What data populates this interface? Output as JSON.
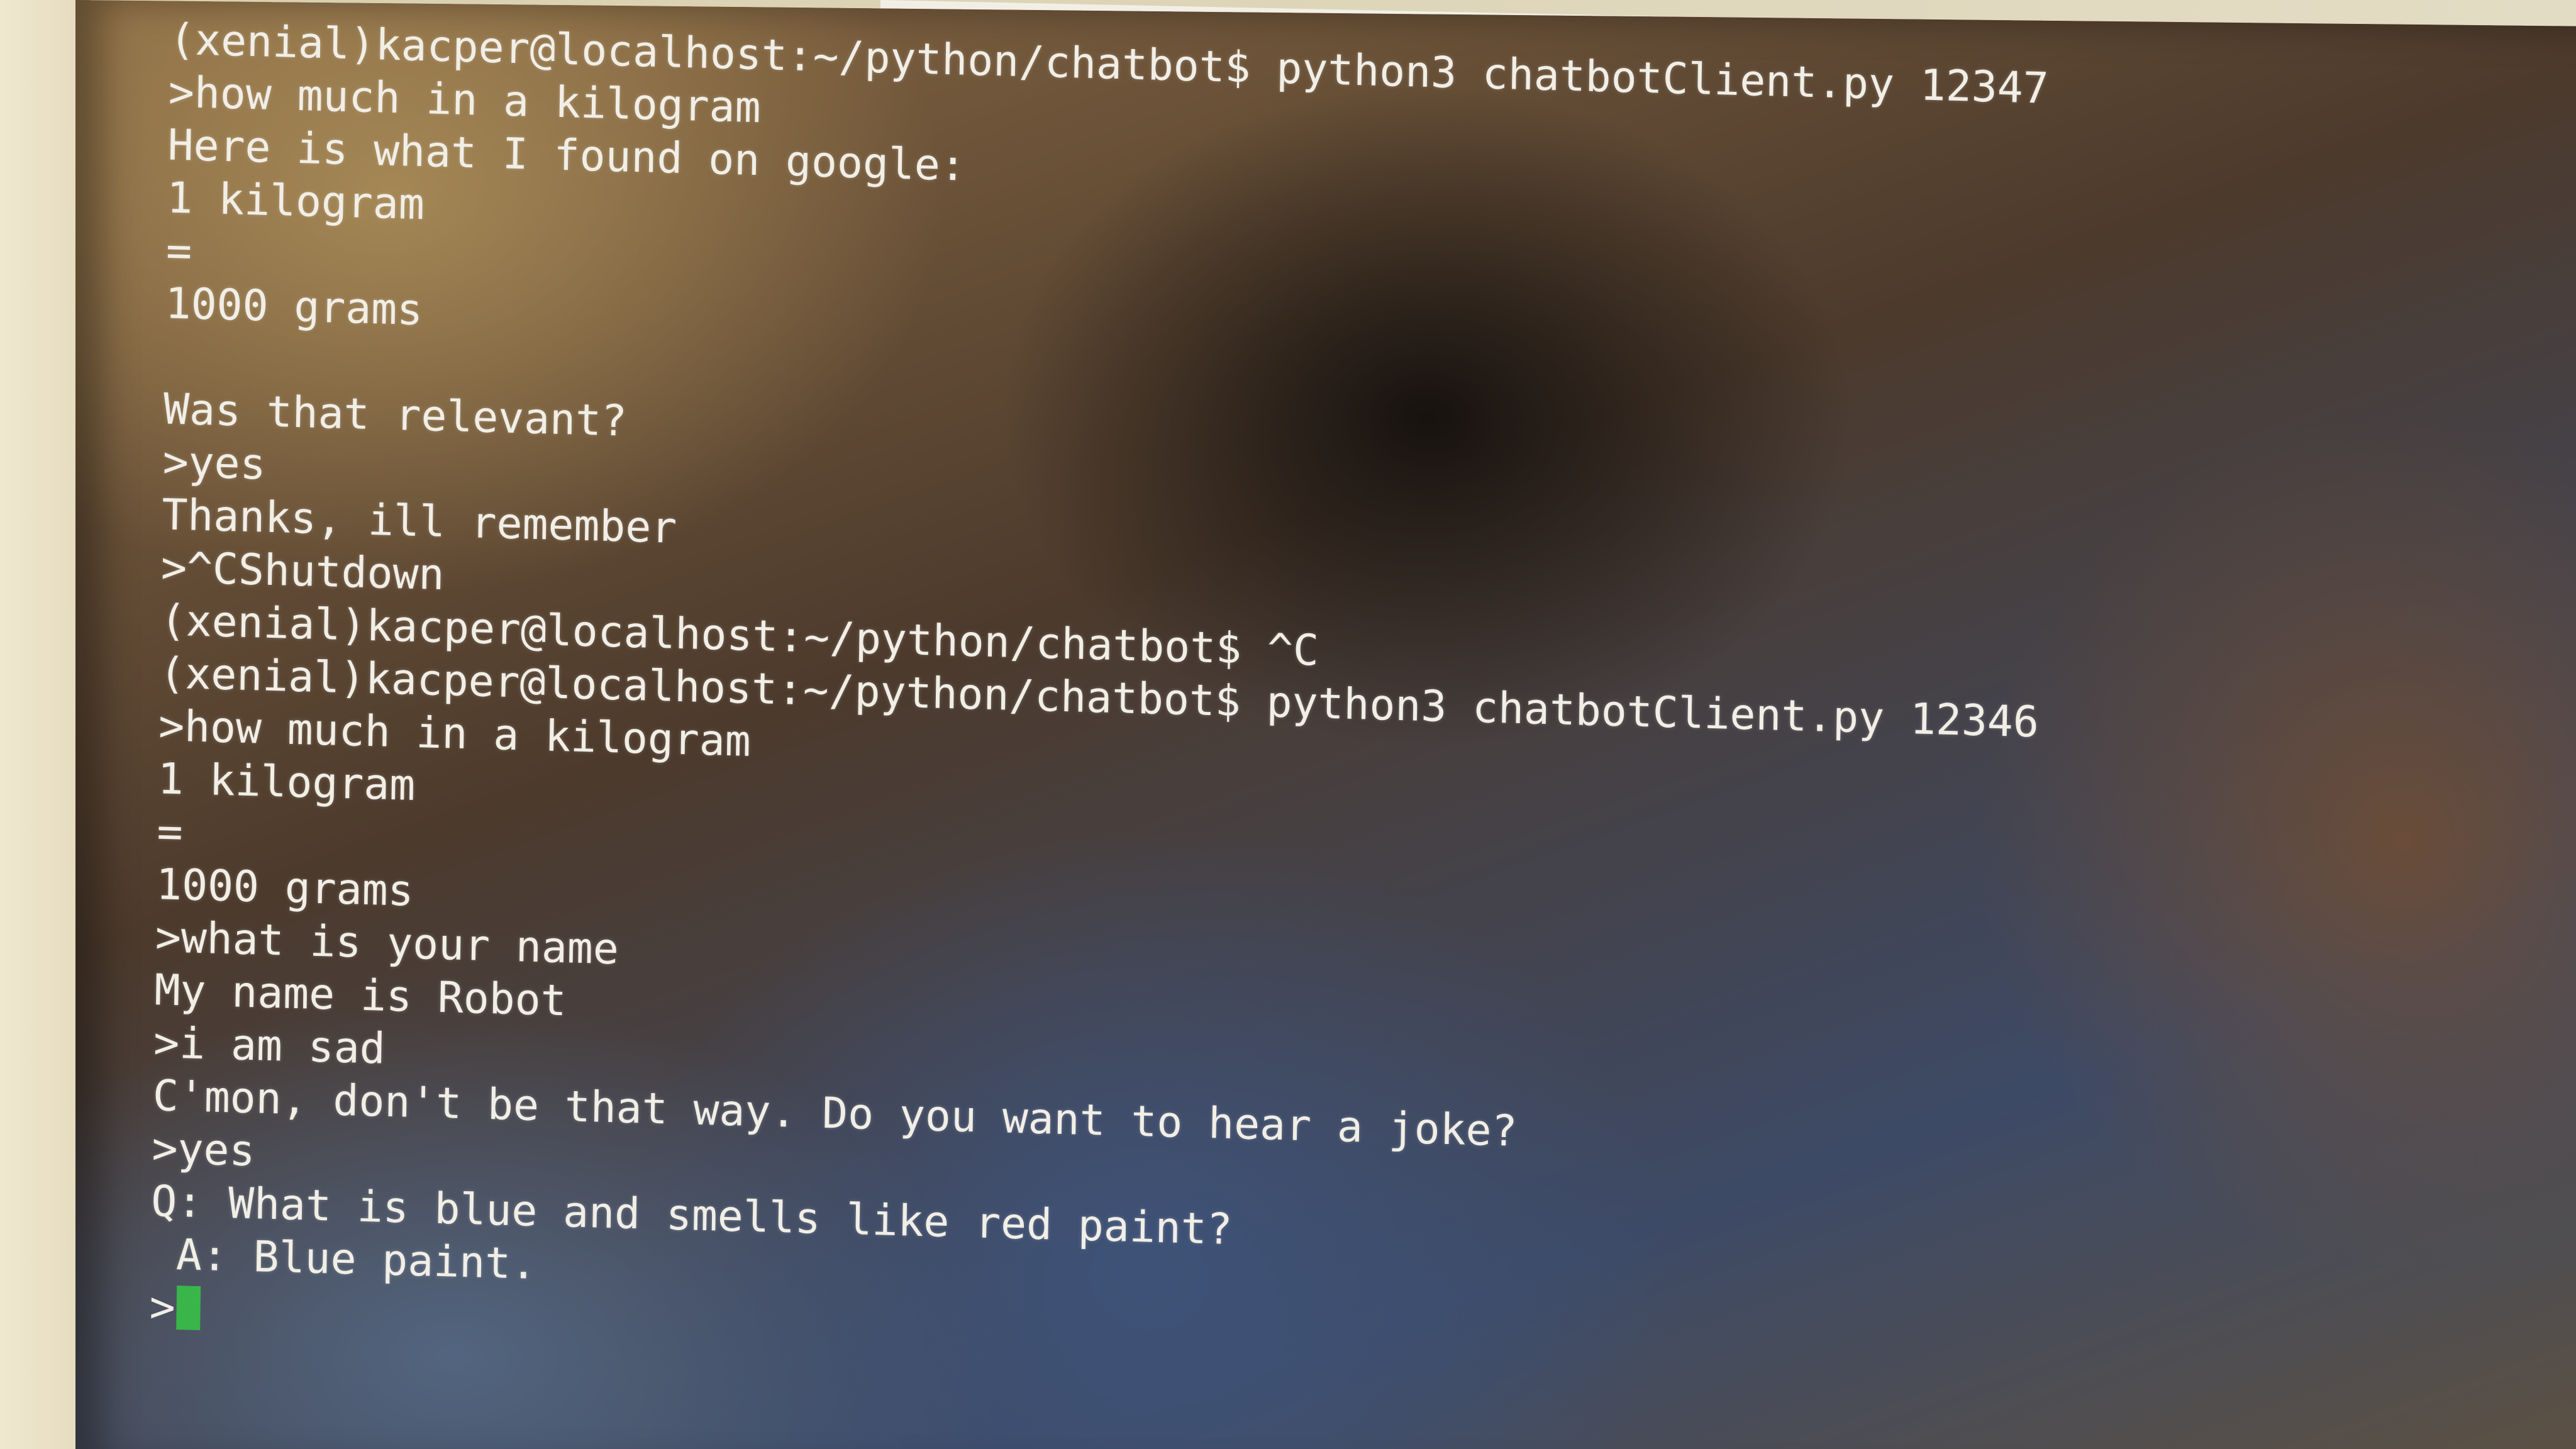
{
  "terminal": {
    "lines": [
      "(xenial)kacper@localhost:~/python/chatbot$ python3 chatbotClient.py 12347",
      ">how much in a kilogram",
      "Here is what I found on google:",
      "1 kilogram",
      "=",
      "1000 grams",
      "",
      "Was that relevant?",
      ">yes",
      "Thanks, ill remember",
      ">^CShutdown",
      "(xenial)kacper@localhost:~/python/chatbot$ ^C",
      "(xenial)kacper@localhost:~/python/chatbot$ python3 chatbotClient.py 12346",
      ">how much in a kilogram",
      "1 kilogram",
      "=",
      "1000 grams",
      ">what is your name",
      "My name is Robot",
      ">i am sad",
      "C'mon, don't be that way. Do you want to hear a joke?",
      ">yes",
      "Q: What is blue and smells like red paint?",
      " A: Blue paint."
    ],
    "prompt": ">",
    "cursor_color": "#39b54a"
  }
}
